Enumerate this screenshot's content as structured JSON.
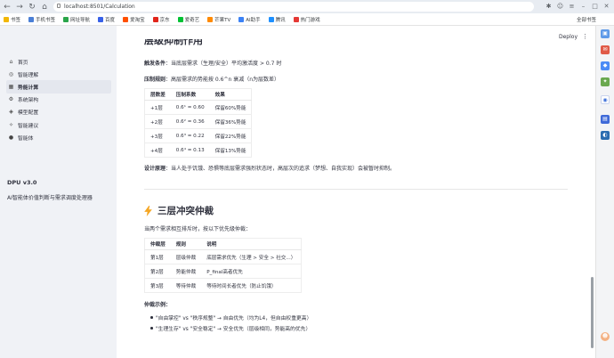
{
  "browser": {
    "url": "localhost:8501/Calculation",
    "bookmarks": [
      {
        "label": "书签",
        "color": "#f2b705"
      },
      {
        "label": "手机书签",
        "color": "#4a7fd6"
      },
      {
        "label": "网址导航",
        "color": "#2aa54a"
      },
      {
        "label": "百度",
        "color": "#3861e8"
      },
      {
        "label": "爱淘宝",
        "color": "#ff5000"
      },
      {
        "label": "京东",
        "color": "#e1251b"
      },
      {
        "label": "爱奇艺",
        "color": "#00c234"
      },
      {
        "label": "芒果TV",
        "color": "#ff8a00"
      },
      {
        "label": "AI助手",
        "color": "#3b82f6"
      },
      {
        "label": "腾讯",
        "color": "#1e90ff"
      },
      {
        "label": "热门游戏",
        "color": "#e53935"
      }
    ],
    "bookmarks_right": "全部书签"
  },
  "sidebar": {
    "items": [
      {
        "label": "首页",
        "icon": "home-icon",
        "glyph": "⌂",
        "active": false
      },
      {
        "label": "智能理解",
        "icon": "brain-icon",
        "glyph": "◎",
        "active": false
      },
      {
        "label": "势能计算",
        "icon": "calc-icon",
        "glyph": "▦",
        "active": true
      },
      {
        "label": "系统架构",
        "icon": "arch-icon",
        "glyph": "⚙",
        "active": false
      },
      {
        "label": "模型配置",
        "icon": "model-icon",
        "glyph": "◈",
        "active": false
      },
      {
        "label": "智能建议",
        "icon": "bulb-icon",
        "glyph": "✧",
        "active": false
      },
      {
        "label": "智能体",
        "icon": "agent-icon",
        "glyph": "●",
        "active": false
      }
    ],
    "version": "DPU v3.0",
    "description": "AI智能体价值判断与需求调度处理器"
  },
  "header": {
    "deploy_label": "Deploy",
    "menu_glyph": "⋮"
  },
  "section1": {
    "heading": "层级抑制作用",
    "trigger_label": "触发条件",
    "trigger_text": "：当底层需求（生理/安全）平均激活度 > 0.7 时",
    "rule_label": "压制规则",
    "rule_text": "：高层需求的势能按 0.6^n 衰减（n为层数差）",
    "table": {
      "headers": [
        "层数差",
        "压制系数",
        "效果"
      ],
      "rows": [
        [
          "+1层",
          "0.6¹ = 0.60",
          "保留60%势能"
        ],
        [
          "+2层",
          "0.6² = 0.36",
          "保留36%势能"
        ],
        [
          "+3层",
          "0.6³ = 0.22",
          "保留22%势能"
        ],
        [
          "+4层",
          "0.6⁴ = 0.13",
          "保留13%势能"
        ]
      ]
    },
    "principle_label": "设计原理",
    "principle_text": "：当人处于饥饿、恐惧等底层需求强烈状态时，高层次的追求（梦想、自我实现）会被暂时抑制。"
  },
  "section2": {
    "heading": "三层冲突仲裁",
    "intro": "当两个需求相互排斥时，按以下优先级仲裁：",
    "table": {
      "headers": [
        "仲裁层",
        "规则",
        "说明"
      ],
      "rows": [
        [
          "第1层",
          "层级仲裁",
          "底层需求优先（生理 > 安全 > 社交...）"
        ],
        [
          "第2层",
          "势能仲裁",
          "P_final高者优先"
        ],
        [
          "第3层",
          "等待仲裁",
          "等待时间长者优先（防止饥饿）"
        ]
      ]
    },
    "examples_label": "仲裁示例：",
    "examples": [
      "\"自由掌控\" vs \"秩序规整\" → 自由优先（均为L4，但自由权重更高）",
      "\"生理生存\" vs \"安全稳定\" → 安全优先（层级相同，势能高的优先）"
    ]
  }
}
